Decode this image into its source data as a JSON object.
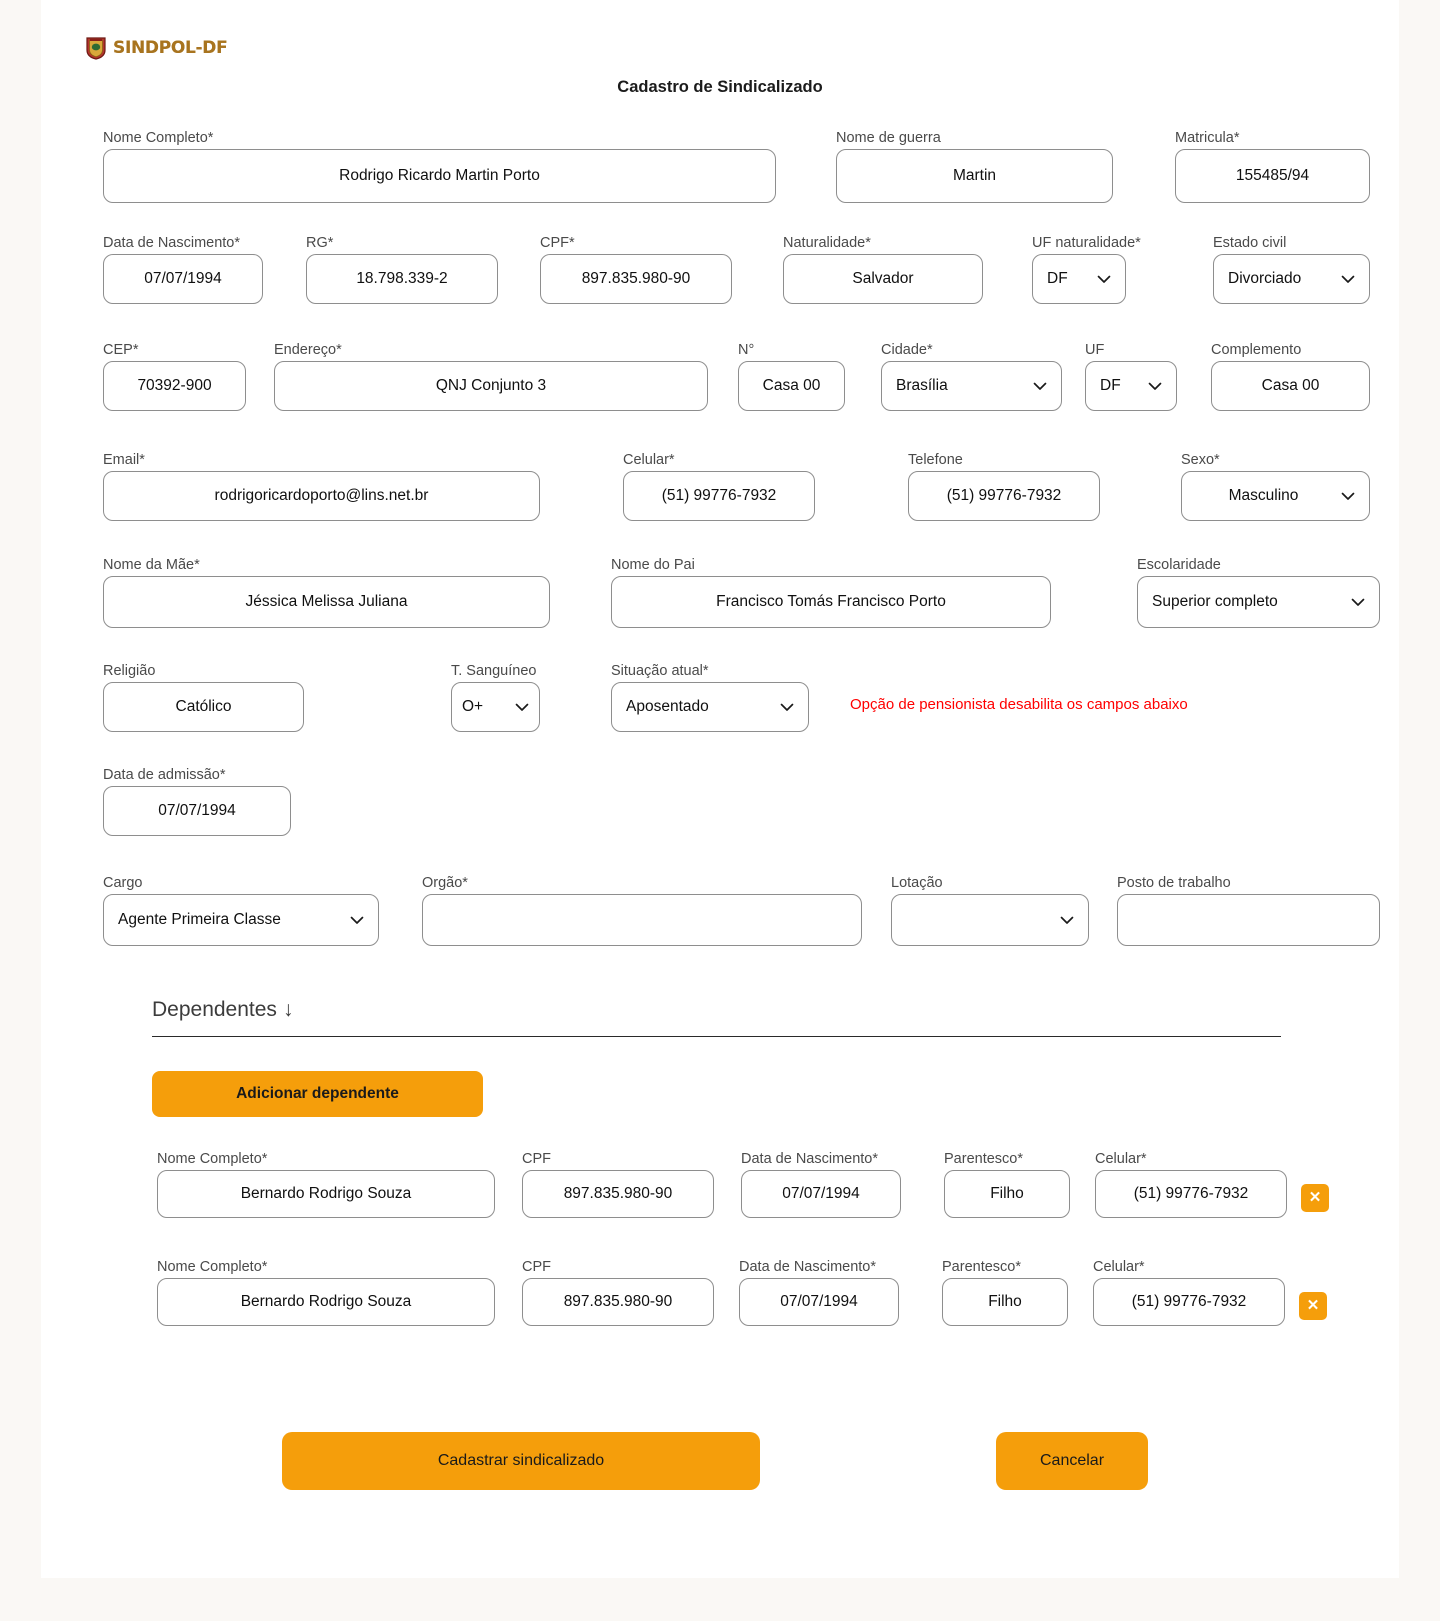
{
  "brand": {
    "name": "SINDPOL-DF",
    "icon": "badge-icon"
  },
  "header": {
    "title": "Cadastro de Sindicalizado"
  },
  "notes": {
    "pensionista": "Opção de pensionista desabilita os campos abaixo"
  },
  "fields": {
    "nome_completo": {
      "label": "Nome Completo*",
      "value": "Rodrigo Ricardo Martin Porto"
    },
    "nome_guerra": {
      "label": "Nome de guerra",
      "value": "Martin"
    },
    "matricula": {
      "label": "Matricula*",
      "value": "155485/94"
    },
    "data_nascimento": {
      "label": "Data de Nascimento*",
      "value": "07/07/1994"
    },
    "rg": {
      "label": "RG*",
      "value": "18.798.339-2"
    },
    "cpf": {
      "label": "CPF*",
      "value": "897.835.980-90"
    },
    "naturalidade": {
      "label": "Naturalidade*",
      "value": "Salvador"
    },
    "uf_naturalidade": {
      "label": "UF naturalidade*",
      "value": "DF"
    },
    "estado_civil": {
      "label": "Estado civil",
      "value": "Divorciado"
    },
    "cep": {
      "label": "CEP*",
      "value": "70392-900"
    },
    "endereco": {
      "label": "Endereço*",
      "value": "QNJ Conjunto 3"
    },
    "numero": {
      "label": "N°",
      "value": "Casa 00"
    },
    "cidade": {
      "label": "Cidade*",
      "value": "Brasília"
    },
    "uf": {
      "label": "UF",
      "value": "DF"
    },
    "complemento": {
      "label": "Complemento",
      "value": "Casa 00"
    },
    "email": {
      "label": "Email*",
      "value": "rodrigoricardoporto@lins.net.br"
    },
    "celular": {
      "label": "Celular*",
      "value": "(51) 99776-7932"
    },
    "telefone": {
      "label": "Telefone",
      "value": "(51) 99776-7932"
    },
    "sexo": {
      "label": "Sexo*",
      "value": "Masculino"
    },
    "nome_mae": {
      "label": "Nome da Mãe*",
      "value": "Jéssica Melissa Juliana"
    },
    "nome_pai": {
      "label": "Nome do Pai",
      "value": "Francisco Tomás Francisco Porto"
    },
    "escolaridade": {
      "label": "Escolaridade",
      "value": "Superior completo"
    },
    "religiao": {
      "label": "Religião",
      "value": "Católico"
    },
    "tipo_sanguineo": {
      "label": "T. Sanguíneo",
      "value": "O+"
    },
    "situacao_atual": {
      "label": "Situação atual*",
      "value": "Aposentado"
    },
    "data_admissao": {
      "label": "Data de admissão*",
      "value": "07/07/1994"
    },
    "cargo": {
      "label": "Cargo",
      "value": "Agente Primeira Classe"
    },
    "orgao": {
      "label": "Orgão*",
      "value": ""
    },
    "lotacao": {
      "label": "Lotação",
      "value": ""
    },
    "posto_trabalho": {
      "label": "Posto de trabalho",
      "value": ""
    }
  },
  "dependentes": {
    "section_title": "Dependentes",
    "section_arrow": "↓",
    "add_button": "Adicionar dependente",
    "remove_icon": "✕",
    "labels": {
      "nome": "Nome Completo*",
      "cpf": "CPF",
      "data_nascimento": "Data de Nascimento*",
      "parentesco": "Parentesco*",
      "celular": "Celular*"
    },
    "rows": [
      {
        "nome": "Bernardo Rodrigo Souza",
        "cpf": "897.835.980-90",
        "data_nascimento": "07/07/1994",
        "parentesco": "Filho",
        "celular": "(51) 99776-7932"
      },
      {
        "nome": "Bernardo Rodrigo Souza",
        "cpf": "897.835.980-90",
        "data_nascimento": "07/07/1994",
        "parentesco": "Filho",
        "celular": "(51) 99776-7932"
      }
    ]
  },
  "actions": {
    "submit": "Cadastrar sindicalizado",
    "cancel": "Cancelar"
  },
  "colors": {
    "accent": "#f59e0b",
    "warning": "#ff0000",
    "border": "#8e8e8e",
    "page_bg": "#faf8f5"
  }
}
